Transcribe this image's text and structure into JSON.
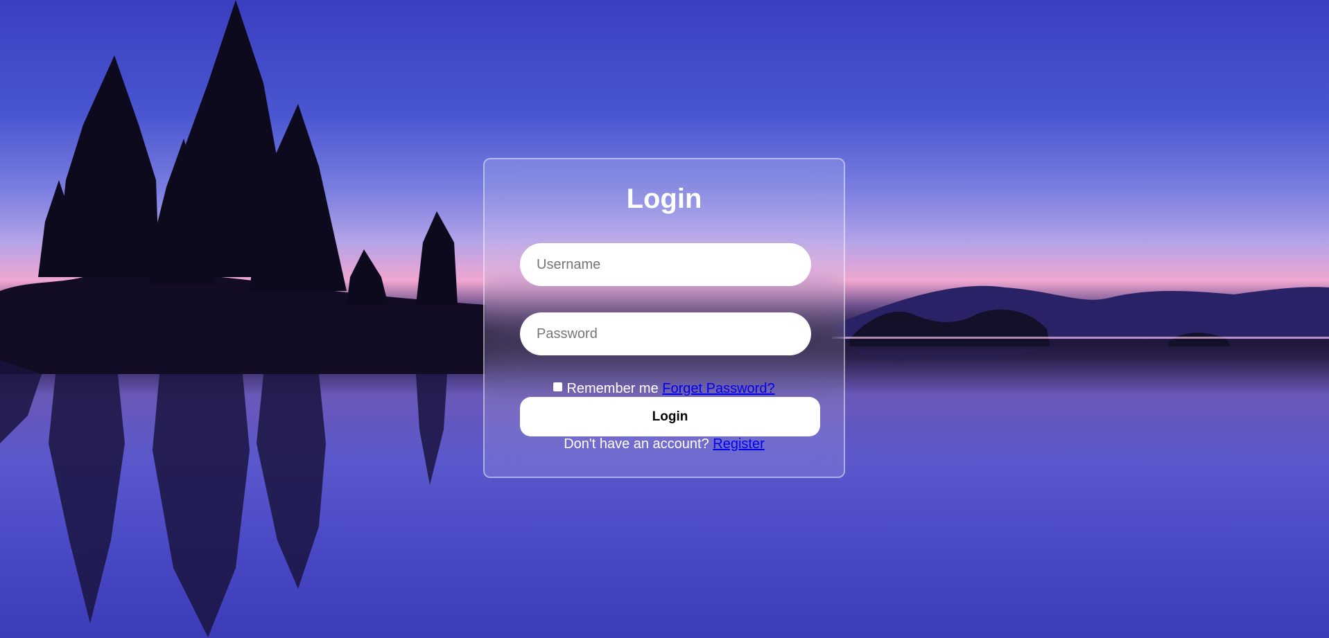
{
  "colors": {
    "sky_top": "#3a3fc0",
    "horizon_pink": "#f0a6d0",
    "card_border": "#ffffff",
    "link": "#0000ee",
    "button_bg": "#ffffff"
  },
  "form": {
    "title": "Login",
    "username_placeholder": "Username",
    "password_placeholder": "Password",
    "username_value": "",
    "password_value": "",
    "remember_label": "Remember me",
    "remember_checked": false,
    "forgot_link": "Forget Password?",
    "submit_label": "Login",
    "register_prompt": "Don't have an account?",
    "register_link": "Register"
  }
}
